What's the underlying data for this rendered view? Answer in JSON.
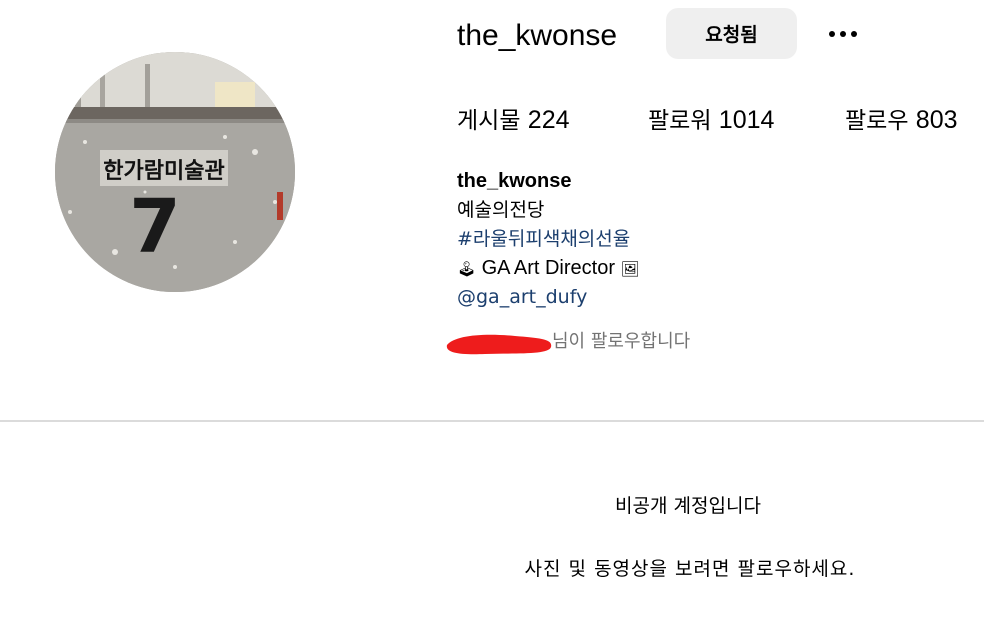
{
  "profile": {
    "username": "the_kwonse",
    "requested_button_label": "요청됨",
    "more_options_icon": "ellipsis-icon"
  },
  "stats": {
    "posts_label": "게시물",
    "posts_count": "224",
    "followers_label": "팔로워",
    "followers_count": "1014",
    "following_label": "팔로우",
    "following_count": "803"
  },
  "bio": {
    "name": "the_kwonse",
    "line1": "예술의전당",
    "hashtag": "#라울뒤피색채의선율",
    "role_emoji_left": "🕹",
    "role_text": "GA Art Director",
    "role_emoji_right": "🖼",
    "mention": "@ga_art_dufy"
  },
  "followed_by": {
    "text": "님이 팔로우합니다"
  },
  "avatar": {
    "sign_text": "한가람미술관",
    "number": "7"
  },
  "private_notice": {
    "title": "비공개 계정입니다",
    "subtitle": "사진 및 동영상을 보려면 팔로우하세요."
  }
}
